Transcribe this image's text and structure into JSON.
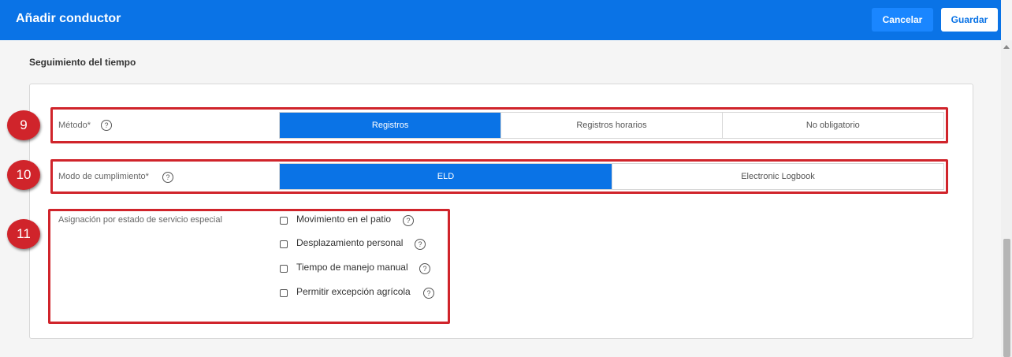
{
  "header": {
    "title": "Añadir conductor",
    "cancel_label": "Cancelar",
    "save_label": "Guardar"
  },
  "section": {
    "title": "Seguimiento del tiempo"
  },
  "annotations": [
    "9",
    "10",
    "11"
  ],
  "method": {
    "label": "Método*",
    "help": "?",
    "options": [
      "Registros",
      "Registros horarios",
      "No obligatorio"
    ],
    "selected": "Registros"
  },
  "compliance": {
    "label": "Modo de cumplimiento*",
    "help": "?",
    "options": [
      "ELD",
      "Electronic Logbook"
    ],
    "selected": "ELD"
  },
  "special_duty": {
    "label": "Asignación por estado de servicio especial",
    "items": [
      {
        "label": "Movimiento en el patio",
        "help": "?",
        "checked": false
      },
      {
        "label": "Desplazamiento personal",
        "help": "?",
        "checked": false
      },
      {
        "label": "Tiempo de manejo manual",
        "help": "?",
        "checked": false
      },
      {
        "label": "Permitir excepción agrícola",
        "help": "?",
        "checked": false
      }
    ]
  },
  "colors": {
    "primary": "#0a73e6",
    "highlight": "#d0242b"
  }
}
